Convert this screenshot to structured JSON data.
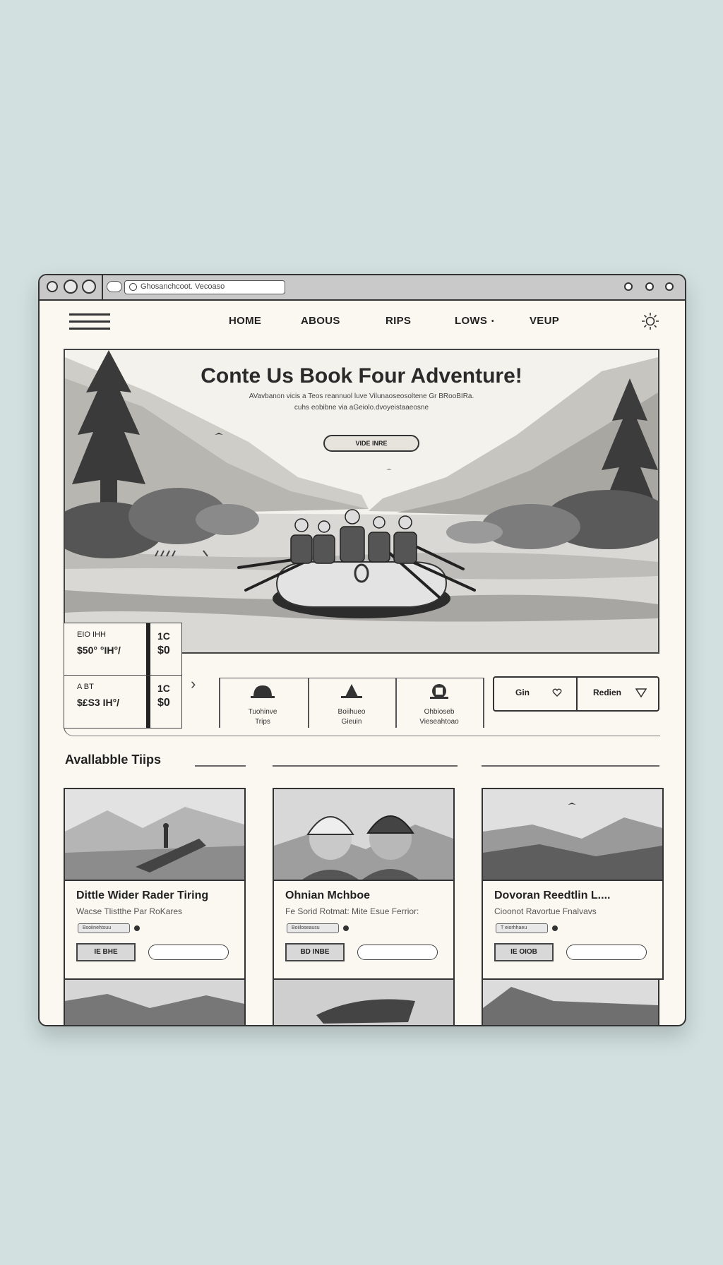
{
  "browser": {
    "address": "Ghosanchcoot. Vecoaso"
  },
  "nav": {
    "items": [
      "HOME",
      "ABOUS",
      "RIPS",
      "LOWS",
      "VEUP"
    ],
    "bullet": "•"
  },
  "hero": {
    "title": "Conte Us Book Four Adventure!",
    "subtitle_line1": "AVavbanon vicis а Teos reannuol luve Vilunaoseosoltene Gr BRooBIRa.",
    "subtitle_line2": "cuhs eobibne via aGeiolo.dvoyeistaaeosne",
    "button": "VIDE INRE"
  },
  "prices": [
    {
      "l1": "EIO IHH",
      "l2": "$50° °IH°/",
      "n1": "1C",
      "n2": "$0"
    },
    {
      "l1": "A BT",
      "l2": "$£S3 IH°/",
      "n1": "1C",
      "n2": "$0"
    }
  ],
  "features": [
    {
      "line1": "Tuohinve",
      "line2": "Trips"
    },
    {
      "line1": "Boiihueo",
      "line2": "Gieuin"
    },
    {
      "line1": "Ohbioseb",
      "line2": "Vieseahtoao"
    }
  ],
  "toggle": {
    "left": "Gin",
    "right": "Redien"
  },
  "section": {
    "title": "Avallabble Tiips"
  },
  "cards": [
    {
      "title": "Dittle Wider Rader Tiring",
      "subtitle": "Wacse Tlistthe Par RoKares",
      "pill": "Bsoiinehtsuu",
      "btn": "IE BHE"
    },
    {
      "title": "Ohnian Mchboe",
      "subtitle": "Fe Sorid Rotmat: Mite Esue Ferrior:",
      "pill": "Boiiloseausu",
      "btn": "BD INBE"
    },
    {
      "title": "Dovoran Reedtlin L....",
      "subtitle": "Cioonot Ravortue Fnalvavs",
      "pill": "T eiorhhaeu",
      "btn": "IE OIOB"
    }
  ],
  "colors": {
    "frame": "#333333",
    "paper": "#fbf8f1",
    "background": "#d2e0e0"
  }
}
